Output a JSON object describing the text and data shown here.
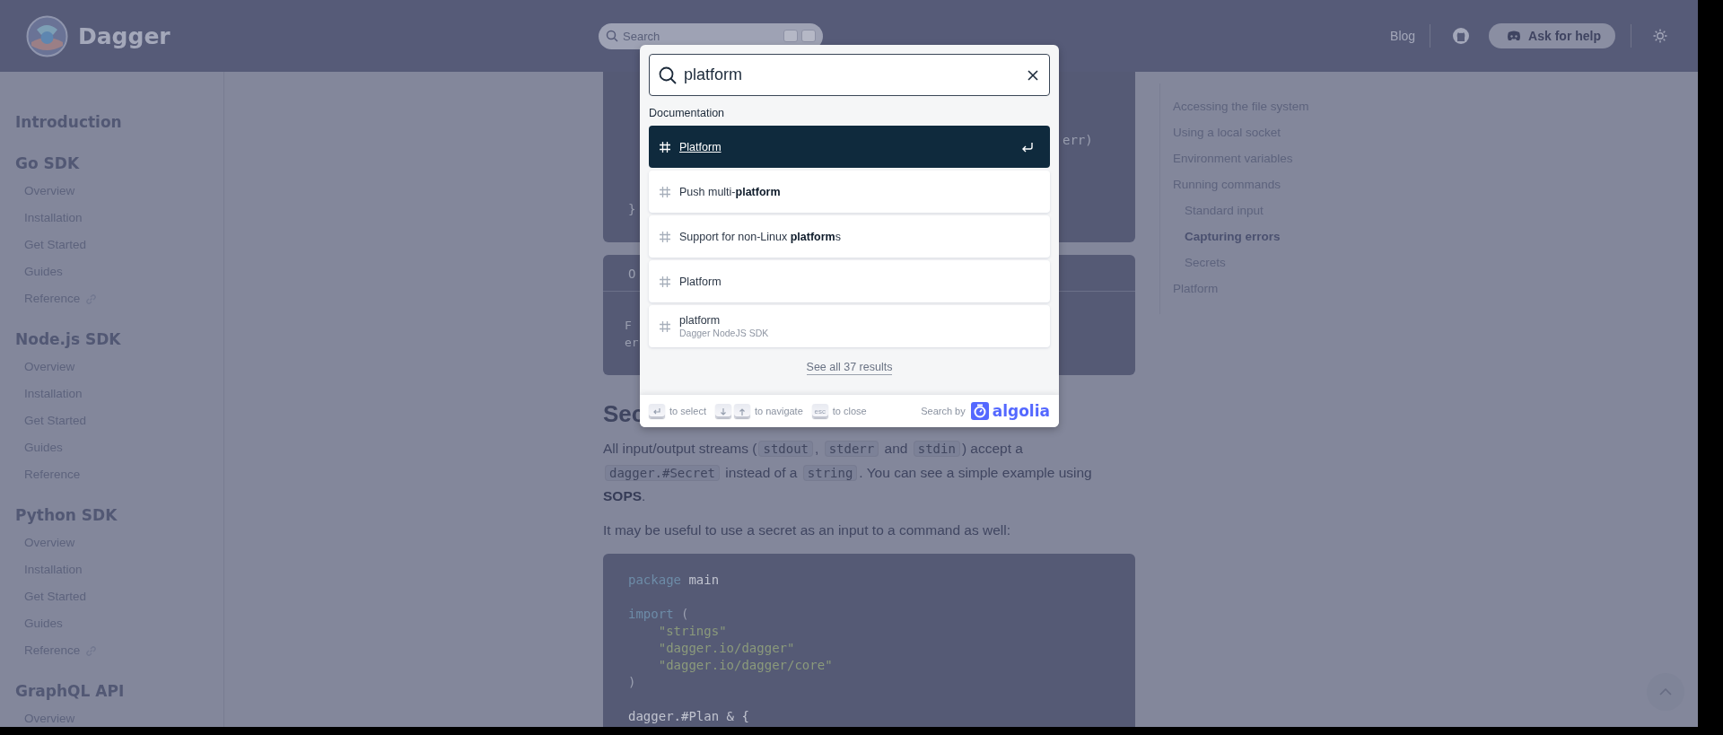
{
  "header": {
    "logo_text": "Dagger",
    "search": {
      "placeholder": "Search"
    },
    "links": [
      {
        "label": "Blog"
      }
    ],
    "help_button": "Ask for help"
  },
  "sidebar": {
    "groups": [
      {
        "title": "Introduction"
      },
      {
        "title": "Go SDK",
        "items": [
          {
            "label": "Overview",
            "external": false
          },
          {
            "label": "Installation",
            "external": false
          },
          {
            "label": "Get Started",
            "external": false
          },
          {
            "label": "Guides",
            "external": false
          },
          {
            "label": "Reference",
            "external": true
          }
        ]
      },
      {
        "title": "Node.js SDK",
        "items": [
          {
            "label": "Overview",
            "external": false
          },
          {
            "label": "Installation",
            "external": false
          },
          {
            "label": "Get Started",
            "external": false
          },
          {
            "label": "Guides",
            "external": false
          },
          {
            "label": "Reference",
            "external": false
          }
        ]
      },
      {
        "title": "Python SDK",
        "items": [
          {
            "label": "Overview",
            "external": false
          },
          {
            "label": "Installation",
            "external": false
          },
          {
            "label": "Get Started",
            "external": false
          },
          {
            "label": "Guides",
            "external": false
          },
          {
            "label": "Reference",
            "external": true
          }
        ]
      },
      {
        "title": "GraphQL API",
        "items": [
          {
            "label": "Overview",
            "external": false
          }
        ]
      }
    ]
  },
  "main": {
    "code_top": {
      "lines": [
        {
          "kind": "tail",
          "text": "err)"
        },
        {
          "kind": "full",
          "text": "}"
        }
      ]
    },
    "output": {
      "tab_label": "O",
      "lines": [
        "F",
        "er"
      ]
    },
    "heading": "Sec",
    "paragraphs": [
      {
        "segments": [
          {
            "kind": "text",
            "text": "All input/output streams ("
          },
          {
            "kind": "code",
            "text": "stdout"
          },
          {
            "kind": "text",
            "text": ", "
          },
          {
            "kind": "code",
            "text": "stderr"
          },
          {
            "kind": "text",
            "text": " and "
          },
          {
            "kind": "code",
            "text": "stdin"
          },
          {
            "kind": "text",
            "text": ") accept a "
          },
          {
            "kind": "code",
            "text": "dagger.#Secret"
          },
          {
            "kind": "text",
            "text": " instead of a "
          },
          {
            "kind": "code",
            "text": "string"
          },
          {
            "kind": "text",
            "text": ". You can see a simple example using **SOPS**."
          }
        ]
      },
      {
        "segments": [
          {
            "kind": "text",
            "text": "It may be useful to use a secret as an input to a command as well:"
          }
        ]
      }
    ],
    "code": {
      "blocks": [
        [
          {
            "tokens": [
              {
                "kind": "keyword",
                "text": "package"
              },
              {
                "kind": "plain",
                "text": " main"
              }
            ]
          }
        ],
        [
          {
            "tokens": [
              {
                "kind": "keyword",
                "text": "import"
              },
              {
                "kind": "punct",
                "text": " ("
              }
            ]
          },
          {
            "tokens": [
              {
                "kind": "string",
                "text": "    \"strings\""
              }
            ]
          },
          {
            "tokens": [
              {
                "kind": "string",
                "text": "    \"dagger.io/dagger\""
              }
            ]
          },
          {
            "tokens": [
              {
                "kind": "string",
                "text": "    \"dagger.io/dagger/core\""
              }
            ]
          },
          {
            "tokens": [
              {
                "kind": "punct",
                "text": ")"
              }
            ]
          }
        ],
        [
          {
            "tokens": [
              {
                "kind": "plain",
                "text": "dagger.#Plan & {"
              }
            ]
          }
        ]
      ]
    }
  },
  "toc": {
    "items": [
      {
        "label": "Accessing the file system",
        "selected": false
      },
      {
        "label": "Using a local socket",
        "selected": false
      },
      {
        "label": "Environment variables",
        "selected": false
      },
      {
        "label": "Running commands",
        "selected": false,
        "children": [
          {
            "label": "Standard input",
            "selected": false
          },
          {
            "label": "Capturing errors",
            "selected": true
          },
          {
            "label": "Secrets",
            "selected": false
          }
        ]
      },
      {
        "label": "Platform",
        "selected": false
      }
    ]
  },
  "search": {
    "query": "platform",
    "section": "Documentation",
    "hits": [
      {
        "title": "Platform",
        "selected": true
      },
      {
        "title": "Push multi-**platform**",
        "selected": false
      },
      {
        "title": "Support for non-Linux **platform**s",
        "selected": false
      },
      {
        "title": "Platform",
        "selected": false
      },
      {
        "title": "platform",
        "subtitle": "Dagger NodeJS SDK",
        "selected": false
      }
    ],
    "see_all": "See all 37 results",
    "footer": {
      "hints": [
        {
          "keys": [
            {
              "kind": "enter"
            }
          ],
          "label": "to select"
        },
        {
          "keys": [
            {
              "kind": "down"
            },
            {
              "kind": "up"
            }
          ],
          "label": "to navigate"
        },
        {
          "keys": [
            {
              "kind": "text",
              "text": "esc"
            }
          ],
          "label": "to close"
        }
      ],
      "search_by": "Search by",
      "brand": "algolia"
    }
  }
}
